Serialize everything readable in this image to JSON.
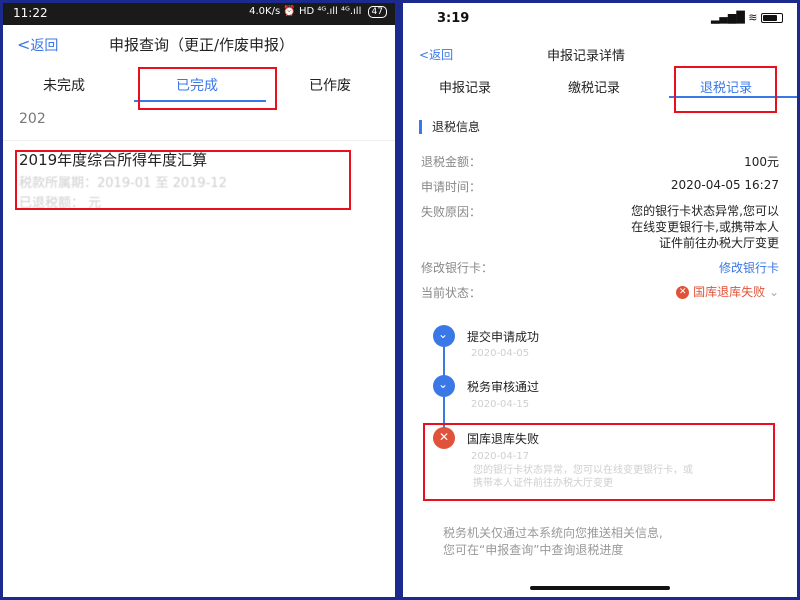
{
  "left": {
    "status_bar": {
      "time": "11:22",
      "right": "4.0K/s ⏰ HD ⁴ᴳ.ıll ⁴ᴳ.ıll",
      "battery": "47"
    },
    "nav": {
      "back_label": "返回",
      "title": "申报查询（更正/作废申报）"
    },
    "tabs": [
      "未完成",
      "已完成",
      "已作废"
    ],
    "year_label": "202",
    "record": {
      "title": "2019年度综合所得年度汇算",
      "period": "税款所属期：2019-01 至 2019-12",
      "refunded": "已退税额：        元"
    }
  },
  "right": {
    "status_bar": {
      "time": "3:19"
    },
    "nav": {
      "back_label": "返回",
      "title": "申报记录详情"
    },
    "tabs": [
      "申报记录",
      "缴税记录",
      "退税记录"
    ],
    "section_title": "退税信息",
    "fields": [
      {
        "label": "退税金额：",
        "value": "100元"
      },
      {
        "label": "申请时间：",
        "value": "2020-04-05 16:27"
      },
      {
        "label": "失败原因：",
        "value_lines": [
          "您的银行卡状态异常,您可以",
          "在线变更银行卡,或携带本人",
          "证件前往办税大厅变更"
        ]
      },
      {
        "label": "修改银行卡：",
        "value": "修改银行卡"
      },
      {
        "label": "当前状态：",
        "value": "国库退库失败"
      }
    ],
    "timeline": [
      {
        "title": "提交申请成功",
        "date": "2020-04-05",
        "state": "done"
      },
      {
        "title": "税务审核通过",
        "date": "2020-04-15",
        "state": "done"
      },
      {
        "title": "国库退库失败",
        "date": "2020-04-17",
        "state": "failed",
        "detail_lines": [
          "您的银行卡状态异常，您可以在线变更银行卡，或",
          "携带本人证件前往办税大厅变更"
        ]
      }
    ],
    "footer_lines": [
      "税务机关仅通过本系统向您推送相关信息,",
      "您可在“申报查询”中查询退税进度"
    ]
  },
  "colors": {
    "accent": "#3b78e7",
    "highlight_box": "#e8101c",
    "fail": "#e0533a",
    "frame": "#1b2a8c"
  }
}
